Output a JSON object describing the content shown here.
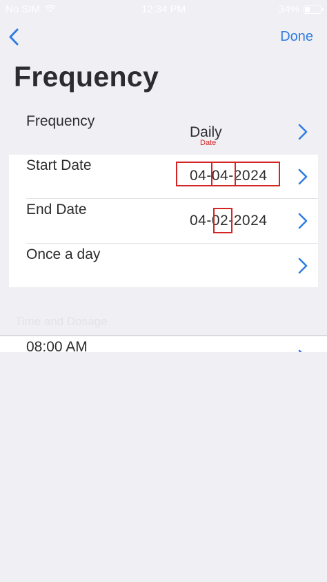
{
  "status_bar": {
    "carrier": "No SIM",
    "time": "12:34 PM",
    "battery": "34%",
    "battery_level": 0.34
  },
  "nav": {
    "done_label": "Done"
  },
  "page_title": "Frequency",
  "rows": {
    "frequency": {
      "label": "Frequency",
      "value": "Daily",
      "sub_label": "Date"
    },
    "start_date": {
      "label": "Start Date",
      "value_pre": "04-",
      "value_mid": "04",
      "value_post": "-2024"
    },
    "end_date": {
      "label": "End Date",
      "value_pre": "04-",
      "value_mid": "02",
      "value_post": "-2024"
    },
    "once_a_day": {
      "label": "Once a day"
    }
  },
  "section_header": "Time and Dosage",
  "time_row": {
    "label": "08:00 AM"
  },
  "colors": {
    "accent": "#2f7de1",
    "highlight": "#d52424",
    "background": "#efeff4"
  }
}
